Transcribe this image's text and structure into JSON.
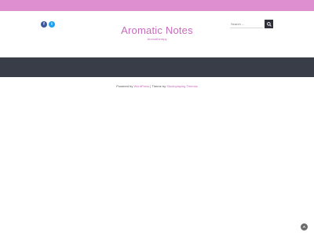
{
  "header": {
    "site_title": "Aromatic Notes",
    "tagline": "Aromatherapy",
    "social": [
      {
        "icon": "facebook-icon",
        "glyph": "f",
        "color": "#3b5998"
      },
      {
        "icon": "twitter-icon",
        "glyph": "t",
        "color": "#1da1f2"
      }
    ],
    "search": {
      "placeholder": "Search ...",
      "button_icon": "search-icon"
    }
  },
  "colors": {
    "accent": "#dd8fcf",
    "link": "#c76bbd",
    "nav_background": "#383d48",
    "button_dark": "#2f2f3a"
  },
  "footer": {
    "powered_by": "Powered by",
    "wordpress_link": "WordPress",
    "separator": " | Theme by ",
    "theme_author": "Studioplaying Themes"
  },
  "scroll_top_icon": "arrow-up-icon"
}
